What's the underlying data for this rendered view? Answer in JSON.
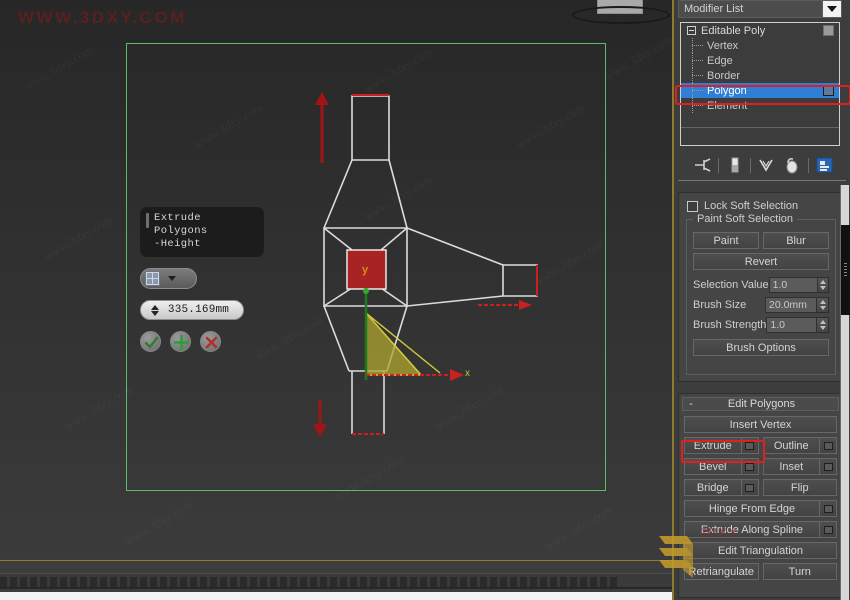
{
  "app": {
    "watermark_top_left": "WWW.3DXY.COM",
    "watermark_tile": "www.3dxy.com",
    "watermark_bottom": "3DXY"
  },
  "viewport": {
    "name": "perspective-viewport",
    "gizmo_labels": {
      "x": "x",
      "y": "y"
    }
  },
  "caddy": {
    "title_line1": "Extrude Polygons",
    "title_line2": "-Height",
    "type_label": "extrude-type-dropdown",
    "value": "335.169mm",
    "ok_label": "OK",
    "apply_label": "Apply",
    "cancel_label": "Cancel"
  },
  "command_panel": {
    "modifier_list": {
      "label": "Modifier List",
      "arrow": "chevron-down-icon"
    },
    "stack": [
      {
        "label": "Editable Poly",
        "level": "root",
        "selected": false,
        "check": true
      },
      {
        "label": "Vertex",
        "level": "child",
        "selected": false,
        "check": false
      },
      {
        "label": "Edge",
        "level": "child",
        "selected": false,
        "check": false
      },
      {
        "label": "Border",
        "level": "child",
        "selected": false,
        "check": false
      },
      {
        "label": "Polygon",
        "level": "child",
        "selected": true,
        "check": true
      },
      {
        "label": "Element",
        "level": "child",
        "selected": false,
        "check": false
      }
    ],
    "stack_icons": [
      "pin-stack-icon",
      "show-end-result-icon",
      "make-unique-icon",
      "remove-modifier-icon",
      "configure-modifier-sets-icon"
    ],
    "soft_selection": {
      "lock_label": "Lock Soft Selection",
      "group_title": "Paint Soft Selection",
      "paint_label": "Paint",
      "blur_label": "Blur",
      "revert_label": "Revert",
      "fields": [
        {
          "label": "Selection Value",
          "value": "1.0"
        },
        {
          "label": "Brush Size",
          "value": "20.0mm"
        },
        {
          "label": "Brush Strength",
          "value": "1.0"
        }
      ],
      "brush_options_label": "Brush Options"
    },
    "edit_polygons": {
      "header": "Edit Polygons",
      "collapse": "-",
      "insert_vertex_label": "Insert Vertex",
      "rows": [
        {
          "left": "Extrude",
          "left_settings": true,
          "right": "Outline",
          "right_settings": true
        },
        {
          "left": "Bevel",
          "left_settings": true,
          "right": "Inset",
          "right_settings": true
        },
        {
          "left": "Bridge",
          "left_settings": true,
          "right": "Flip",
          "right_settings": false
        }
      ],
      "hinge_label": "Hinge From Edge",
      "extrude_spline_label": "Extrude Along Spline",
      "edit_triangulation_label": "Edit Triangulation",
      "retriangulate_label": "Retriangulate",
      "turn_label": "Turn"
    }
  },
  "colors": {
    "highlight_red": "#e02020",
    "selection_blue": "#2f7ed8",
    "selection_green": "#5fba68",
    "face_red": "#a82424",
    "gizmo_yellow": "#cdc13a",
    "arrow_red": "#cc1f1f",
    "panel_gold_border": "#8d7b2f"
  }
}
